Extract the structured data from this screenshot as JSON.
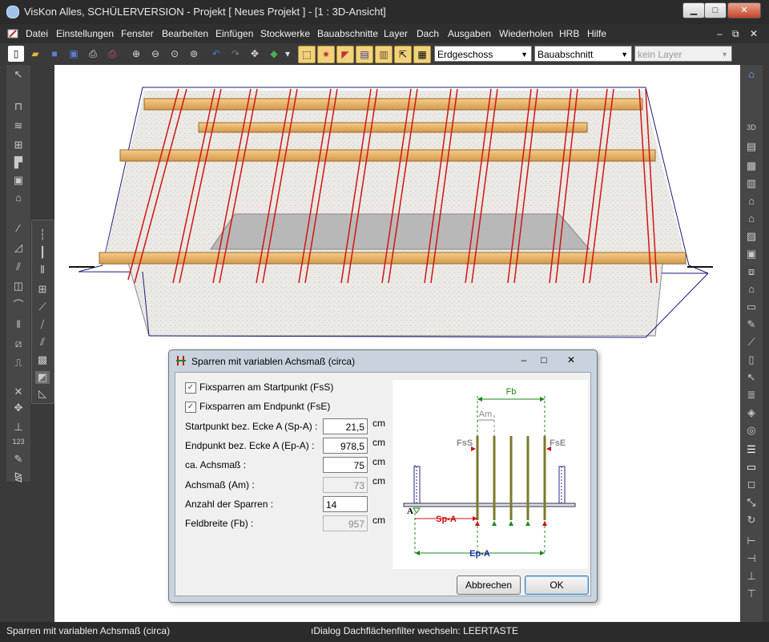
{
  "window": {
    "title": "VisKon Alles, SCHÜLERVERSION - Projekt [ Neues Projekt ]  - [1 : 3D-Ansicht]",
    "controls": {
      "minimize": "▁",
      "maximize": "□",
      "close": "✕"
    },
    "mdi_controls": {
      "minimize": "–",
      "restore": "⧉",
      "close": "✕"
    }
  },
  "menu": [
    "Datei",
    "Einstellungen",
    "Fenster",
    "Bearbeiten",
    "Einfügen",
    "Stockwerke",
    "Bauabschnitte",
    "Layer",
    "Dach",
    "Ausgaben",
    "Wiederholen",
    "HRB",
    "Hilfe"
  ],
  "toolbar": {
    "floor_select": "Erdgeschoss",
    "section_select": "Bauabschnitt",
    "layer_select": "kein Layer",
    "icons": [
      "new-icon",
      "open-icon",
      "save-icon",
      "save-as-icon",
      "print-icon",
      "print-pdf-icon",
      "zoom-in-icon",
      "zoom-out-icon",
      "zoom-all-icon",
      "zoom-window-icon",
      "undo-icon",
      "redo-icon",
      "pan-icon",
      "3d-cube-icon"
    ]
  },
  "dialog": {
    "title": "Sparren mit variablen Achsmaß (circa)",
    "fix_start_label": "Fixsparren am Startpunkt (FsS)",
    "fix_start_checked": true,
    "fix_end_label": "Fixsparren am Endpunkt (FsE)",
    "fix_end_checked": true,
    "fields": [
      {
        "label": "Startpunkt bez. Ecke A (Sp-A) :",
        "value": "21,5",
        "unit": "cm",
        "enabled": true
      },
      {
        "label": "Endpunkt bez. Ecke A (Ep-A) :",
        "value": "978,5",
        "unit": "cm",
        "enabled": true
      },
      {
        "label": "ca. Achsmaß :",
        "value": "75",
        "unit": "cm",
        "enabled": true
      },
      {
        "label": "Achsmaß (Am) :",
        "value": "73",
        "unit": "cm",
        "enabled": false
      },
      {
        "label": "Anzahl der Sparren :",
        "value": "14",
        "unit": "",
        "enabled": true
      },
      {
        "label": "Feldbreite (Fb) :",
        "value": "957",
        "unit": "cm",
        "enabled": false
      }
    ],
    "diagram": {
      "fb": "Fb",
      "am": "Am",
      "fss": "FsS",
      "fse": "FsE",
      "a": "A",
      "spa": "Sp-A",
      "epa": "Ep-A",
      "colors": {
        "fb": "#1a8a1a",
        "am": "#8a8a8a",
        "red": "#cc1111",
        "blue": "#1a2a9a"
      }
    },
    "cancel_label": "Abbrechen",
    "ok_label": "OK"
  },
  "status": {
    "left": "Sparren mit variablen Achsmaß (circa)",
    "center": "ıDialog Dachflächenfilter wechseln: LEERTASTE"
  }
}
